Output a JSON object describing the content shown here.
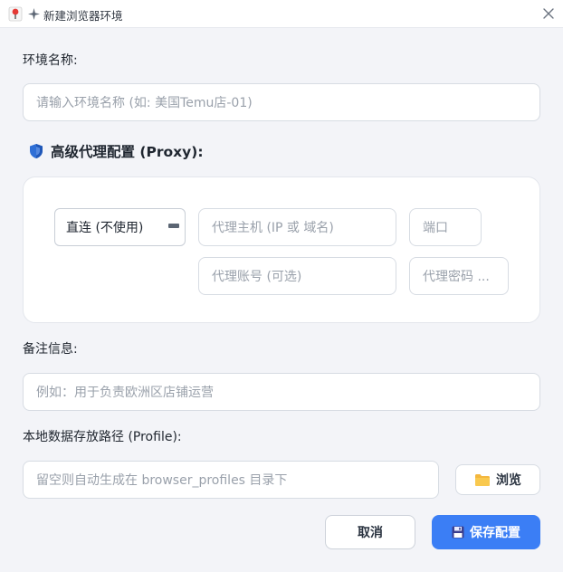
{
  "window": {
    "title": "新建浏览器环境"
  },
  "form": {
    "env_name_label": "环境名称:",
    "env_name_placeholder": "请输入环境名称 (如: 美国Temu店-01)",
    "proxy_section_title": "高级代理配置 (Proxy):",
    "proxy_mode_value": "直连 (不使用)",
    "proxy_host_placeholder": "代理主机 (IP 或 域名)",
    "proxy_port_placeholder": "端口",
    "proxy_user_placeholder": "代理账号 (可选)",
    "proxy_pass_placeholder": "代理密码 ...",
    "notes_label": "备注信息:",
    "notes_placeholder": "例如：用于负责欧洲区店铺运营",
    "profile_label": "本地数据存放路径 (Profile):",
    "profile_placeholder": "留空则自动生成在 browser_profiles 目录下",
    "browse_label": "浏览"
  },
  "actions": {
    "cancel_label": "取消",
    "save_label": "保存配置"
  },
  "icons": {
    "app": "app-pin-icon",
    "title": "sparkle-icon",
    "close": "close-icon",
    "proxy": "shield-icon",
    "browse": "folder-icon",
    "save": "floppy-disk-icon"
  },
  "colors": {
    "accent": "#3b7ef5",
    "background": "#f3f4f8"
  }
}
